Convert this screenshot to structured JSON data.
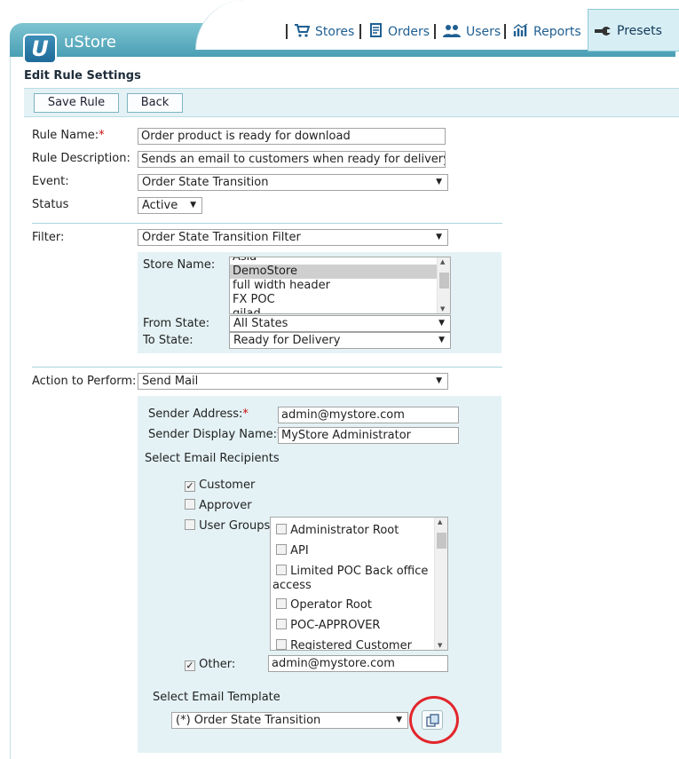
{
  "app": {
    "title": "uStore",
    "logo_letter": "U"
  },
  "nav": {
    "stores": "Stores",
    "orders": "Orders",
    "users": "Users",
    "reports": "Reports",
    "presets": "Presets"
  },
  "page": {
    "title": "Edit Rule Settings"
  },
  "toolbar": {
    "save_label": "Save Rule",
    "back_label": "Back"
  },
  "form": {
    "rule_name_label": "Rule Name:",
    "rule_name_value": "Order product is ready for download",
    "rule_desc_label": "Rule Description:",
    "rule_desc_value": "Sends an email to customers when ready for delivery",
    "event_label": "Event:",
    "event_value": "Order State Transition",
    "status_label": "Status",
    "status_value": "Active",
    "filter_label": "Filter:",
    "filter_value": "Order State Transition Filter",
    "store_name_label": "Store Name:",
    "store_names": [
      "Asia",
      "DemoStore",
      "full width header",
      "FX POC",
      "gilad"
    ],
    "store_selected": "DemoStore",
    "from_state_label": "From State:",
    "from_state_value": "All States",
    "to_state_label": "To State:",
    "to_state_value": "Ready for Delivery",
    "action_label": "Action to Perform:",
    "action_value": "Send Mail",
    "sender_address_label": "Sender Address:",
    "sender_address_value": "admin@mystore.com",
    "sender_display_label": "Sender Display Name:",
    "sender_display_value": "MyStore Administrator",
    "recipients_heading": "Select Email Recipients",
    "customer_label": "Customer",
    "customer_checked": true,
    "approver_label": "Approver",
    "approver_checked": false,
    "user_groups_label": "User Groups",
    "user_groups_checked": false,
    "user_groups": [
      "Administrator Root",
      "API",
      "Limited POC Back office",
      "access",
      "Operator Root",
      "POC-APPROVER",
      "Registered Customer"
    ],
    "other_label": "Other:",
    "other_checked": true,
    "other_value": "admin@mystore.com",
    "template_heading": "Select Email Template",
    "template_value": "(*) Order State Transition"
  },
  "colors": {
    "accent": "#4a9fb4",
    "panel": "#e4f2f5",
    "highlight": "#e2262c",
    "required": "#cc1111"
  }
}
